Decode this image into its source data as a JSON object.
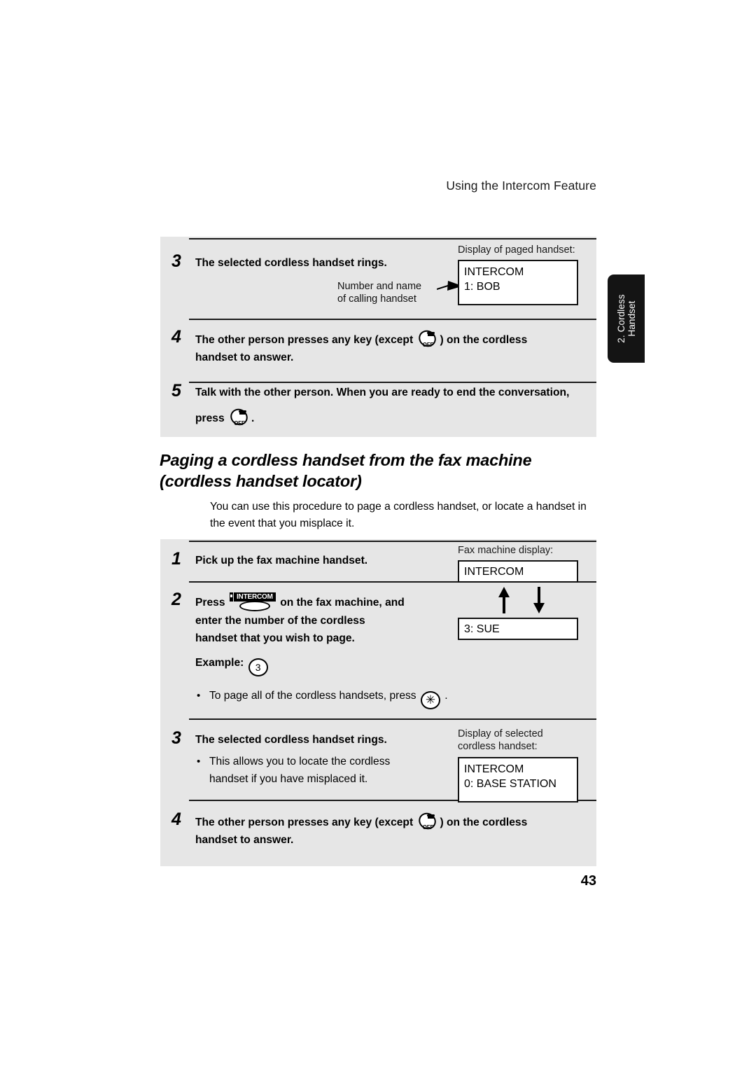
{
  "header": {
    "running_title": "Using the Intercom Feature"
  },
  "side_tab": {
    "line1": "2. Cordless",
    "line2": "Handset"
  },
  "folio": {
    "page_number": "43"
  },
  "icons": {
    "off_key": "off-key-icon",
    "off_label": "OFF",
    "intercom_key": "intercom-key-icon",
    "intercom_label": "INTERCOM",
    "digit_key_3": "3",
    "star_key": "✳",
    "arrow_right": "callout-arrow-icon",
    "arrow_up": "arrow-up-icon",
    "arrow_down": "arrow-down-icon"
  },
  "block_a": {
    "steps": [
      {
        "number": "3",
        "text": "The selected cordless handset rings."
      },
      {
        "number": "4",
        "text_before": "The other person presses any key (except",
        "text_after": ") on the cordless",
        "text_line2": "handset to answer."
      },
      {
        "number": "5",
        "text": "Talk with the other person. When you are ready to end the conversation,",
        "text_line2_before": "press",
        "text_line2_after": "."
      }
    ],
    "callout": {
      "line1": "Number and name",
      "line2": "of calling handset"
    },
    "display": {
      "caption": "Display of paged handset:",
      "line1": "INTERCOM",
      "line2": "1: BOB"
    }
  },
  "section": {
    "heading_line1": "Paging a cordless handset from the fax machine",
    "heading_line2": "(cordless handset locator)",
    "intro": "You can use this procedure to page a cordless handset, or locate a handset in the event that you misplace it."
  },
  "block_b": {
    "steps": [
      {
        "number": "1",
        "text": "Pick up the fax machine handset."
      },
      {
        "number": "2",
        "text_before": "Press",
        "text_after": "on the fax machine, and",
        "text_line2": "enter the number of the cordless",
        "text_line3": "handset that you wish to page.",
        "example_label": "Example:",
        "example_value": "3",
        "note_before": "To page all of the cordless handsets, press",
        "note_after": "."
      },
      {
        "number": "3",
        "text": "The selected cordless handset rings.",
        "note_line1": "This allows you to locate the cordless",
        "note_line2": "handset if you have misplaced it."
      },
      {
        "number": "4",
        "text_before": "The other person presses any key (except",
        "text_after": ") on the cordless",
        "text_line2": "handset to answer."
      }
    ],
    "fax_display": {
      "caption": "Fax machine display:",
      "box1": "INTERCOM",
      "box2": "3: SUE"
    },
    "selected_display": {
      "caption_line1": "Display of selected",
      "caption_line2": "cordless handset:",
      "line1": "INTERCOM",
      "line2": "0: BASE STATION"
    }
  },
  "colors": {
    "block_bg": "#e6e6e6",
    "tab_bg": "#141414",
    "rule": "#1a1a1a",
    "text": "#000000"
  }
}
